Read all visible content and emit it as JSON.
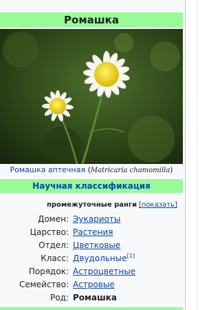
{
  "infobox": {
    "title": "Ромашка",
    "caption_common": "Ромашка аптечная",
    "caption_latin_open": " (",
    "caption_latin": "Matricaria chamomilla",
    "caption_latin_close": ")",
    "section_title": "Научная классификация",
    "ranks_label": "промежуточные ранги",
    "ranks_toggle": "[показать]",
    "taxonomy": [
      {
        "rank": "Домен:",
        "value": "Эукариоты"
      },
      {
        "rank": "Царство:",
        "value": "Растения"
      },
      {
        "rank": "Отдел:",
        "value": "Цветковые"
      },
      {
        "rank": "Класс:",
        "value": "Двудольные",
        "note": "[1]"
      },
      {
        "rank": "Порядок:",
        "value": "Астроцветные"
      },
      {
        "rank": "Семейство:",
        "value": "Астровые"
      },
      {
        "rank": "Род:",
        "value": "Ромашка"
      }
    ]
  },
  "colors": {
    "header_bg": "#98fb98",
    "link": "#0645ad",
    "infobox_bg": "#f8f9fa"
  }
}
